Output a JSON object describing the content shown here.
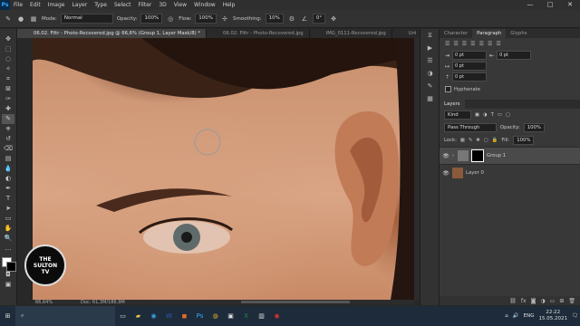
{
  "menu": {
    "logo": "Ps",
    "items": [
      "File",
      "Edit",
      "Image",
      "Layer",
      "Type",
      "Select",
      "Filter",
      "3D",
      "View",
      "Window",
      "Help"
    ]
  },
  "window_controls": [
    "—",
    "□",
    "✕"
  ],
  "options": {
    "mode_label": "Mode:",
    "mode_value": "Normal",
    "opacity_label": "Opacity:",
    "opacity_value": "100%",
    "flow_label": "Flow:",
    "flow_value": "100%",
    "smoothing_label": "Smoothing:",
    "smoothing_value": "10%",
    "angle_value": "0°"
  },
  "tabs": [
    "06.02. Filtr - Photo-Recovered.jpg @ 66,6% (Group 1, Layer Mask/8) *",
    "06.02. Filtr - Photo-Recovered.jpg",
    "IMG_0111-Recovered.jpg",
    "Untitle"
  ],
  "status": {
    "zoom": "66,64%",
    "doc": "Doc: 61,3M/186,9M"
  },
  "panel": {
    "top_tabs": [
      "Character",
      "Paragraph",
      "Glyphs"
    ],
    "fields": [
      "0 pt",
      "0 pt",
      "0 pt",
      "0 pt"
    ],
    "hyphenate": "Hyphenate",
    "layers_tab": "Layers",
    "kind": "Kind",
    "blend": "Pass Through",
    "opacity_label": "Opacity:",
    "opacity_value": "100%",
    "lock_label": "Lock:",
    "fill_label": "Fill:",
    "fill_value": "100%",
    "layers": [
      {
        "name": "Group 1"
      },
      {
        "name": "Layer 0"
      }
    ]
  },
  "watermark": {
    "line1": "THE",
    "line2": "SULTON",
    "line3": "TV"
  },
  "taskbar": {
    "lang": "ENG",
    "time": "22:22",
    "date": "15.05.2021"
  }
}
